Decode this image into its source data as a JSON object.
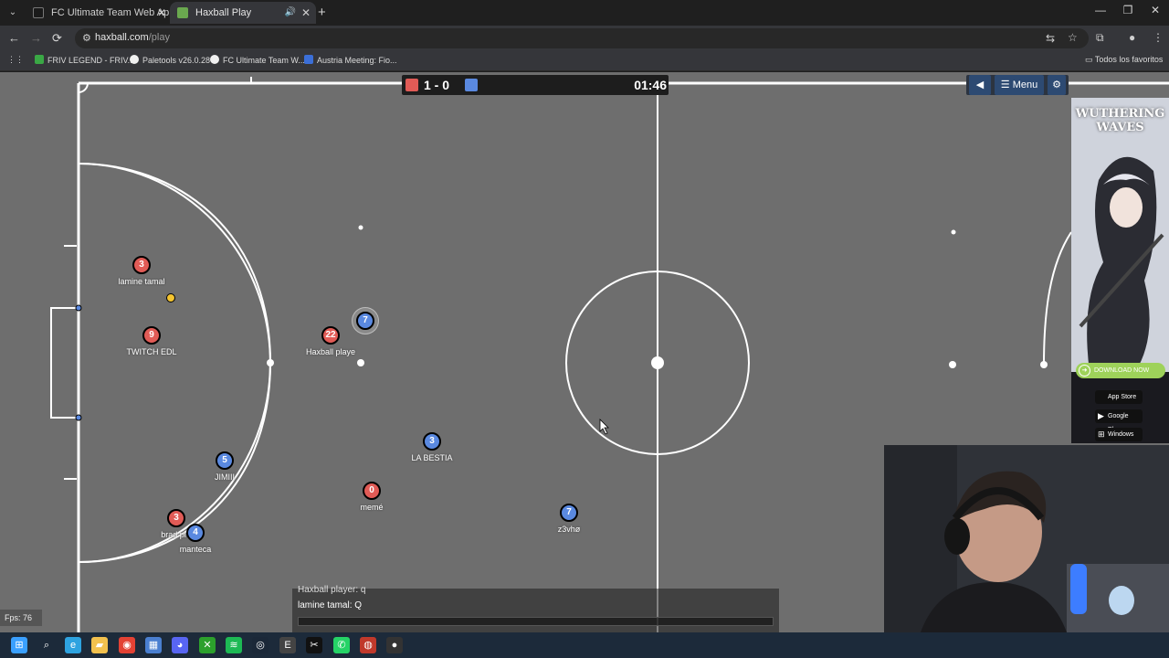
{
  "browser": {
    "tabs": [
      {
        "title": "FC Ultimate Team Web App - E",
        "active": false,
        "favicon_color": "#1a1a1a"
      },
      {
        "title": "Haxball Play",
        "active": true,
        "favicon_color": "#6aa84f"
      }
    ],
    "url_host": "haxball.com",
    "url_path": "/play",
    "bookmarks": [
      {
        "label": "FRIV LEGEND - FRIV...",
        "icon_color": "#3aa845"
      },
      {
        "label": "Paletools v26.0.28",
        "icon_color": "#f0f0f0"
      },
      {
        "label": "FC Ultimate Team W...",
        "icon_color": "#f0f0f0"
      },
      {
        "label": "Austria Meeting: Fio...",
        "icon_color": "#3b6fd8"
      }
    ],
    "bookmarks_folder": "Todos los favoritos",
    "icons": {
      "tab_list": "chevron-down-icon",
      "new_tab": "plus-icon",
      "back": "arrow-left-icon",
      "forward": "arrow-right-icon",
      "reload": "reload-icon",
      "site_info": "tune-icon",
      "translate": "translate-icon",
      "bookmark": "star-icon",
      "extensions": "puzzle-icon",
      "profile": "avatar-icon",
      "more": "kebab-icon"
    },
    "glyphs": {
      "tab_list": "⌄",
      "close": "✕",
      "audio": "🔊",
      "new_tab": "+",
      "minimize": "—",
      "maximize": "❐",
      "close_window": "✕",
      "back": "←",
      "forward": "→",
      "reload": "⟳",
      "site_info": "⚙",
      "translate": "⇆",
      "star": "☆",
      "extensions": "⧉",
      "profile": "●",
      "more": "⋮",
      "apps": "⋮⋮",
      "folder": "▭"
    }
  },
  "game": {
    "score_red": 1,
    "score_blue": 0,
    "score_text": "1 - 0",
    "clock": "01:46",
    "menu_label": "Menu",
    "menu_glyph": "☰",
    "sound_glyph": "◀",
    "settings_glyph": "⚙",
    "red_color": "#e15b56",
    "blue_color": "#5a89e0",
    "fps_label": "Fps: 76",
    "players": [
      {
        "team": "red",
        "number": "3",
        "name": "lamine tamal"
      },
      {
        "team": "red",
        "number": "9",
        "name": "TWITCH EDL"
      },
      {
        "team": "red",
        "number": "22",
        "name": "Haxball playe"
      },
      {
        "team": "blue",
        "number": "7",
        "name": ""
      },
      {
        "team": "blue",
        "number": "3",
        "name": "LA BESTIA"
      },
      {
        "team": "blue",
        "number": "5",
        "name": "JIMIII"
      },
      {
        "team": "red",
        "number": "0",
        "name": "memé"
      },
      {
        "team": "blue",
        "number": "7",
        "name": "z3vhø"
      },
      {
        "team": "red",
        "number": "3",
        "name": "brad pi"
      },
      {
        "team": "blue",
        "number": "4",
        "name": "manteca"
      }
    ],
    "chat": {
      "partial_line": "Haxball player: q",
      "last_line": "lamine tamal: Q"
    }
  },
  "ad": {
    "title_line1": "WUTHERING",
    "title_line2": "WAVES",
    "cta": "DOWNLOAD NOW",
    "stores": [
      "App Store",
      "Google Play",
      "Windows"
    ],
    "store_glyphs": [
      "",
      "▶",
      "⊞"
    ]
  },
  "taskbar": {
    "apps": [
      "start-icon",
      "search-icon",
      "edge-icon",
      "file-explorer-icon",
      "chrome-icon",
      "store-icon",
      "discord-icon",
      "xbox-icon",
      "spotify-icon",
      "steam-icon",
      "epic-icon",
      "capcut-icon",
      "whatsapp-icon",
      "app-icon",
      "obs-icon"
    ],
    "colors": [
      "#3aa0ff",
      "#e8e8e8",
      "#2ea3e0",
      "#f2c14e",
      "#e34234",
      "#4a7fd0",
      "#5865f2",
      "#2ca02c",
      "#1db954",
      "#1b2838",
      "#444444",
      "#111111",
      "#25d366",
      "#c0392b",
      "#333333"
    ],
    "glyphs": [
      "⊞",
      "⌕",
      "e",
      "▰",
      "◉",
      "▦",
      "◕",
      "✕",
      "≋",
      "◎",
      "E",
      "✂",
      "✆",
      "◍",
      "●"
    ]
  }
}
